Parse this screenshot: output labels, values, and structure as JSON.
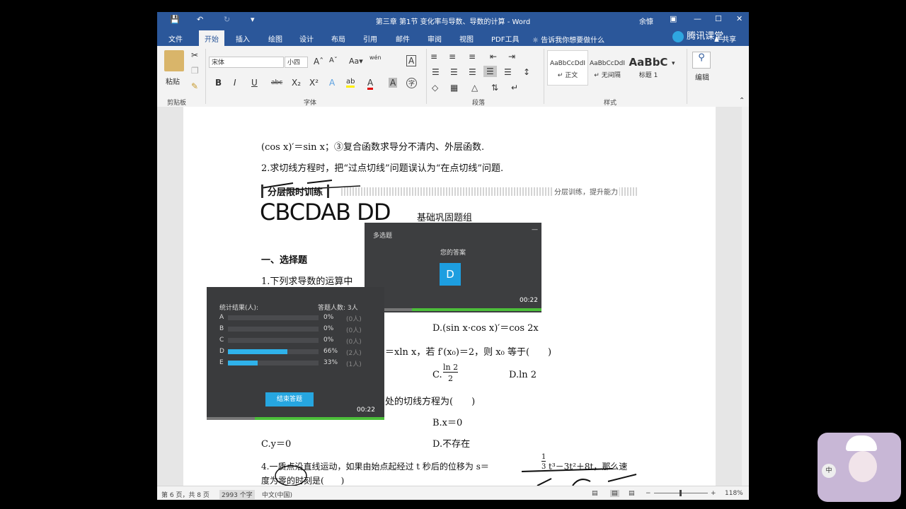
{
  "titlebar": {
    "title": "第三章 第1节 变化率与导数、导数的计算 - Word",
    "user": "余慷"
  },
  "tabs": [
    "文件",
    "开始",
    "插入",
    "绘图",
    "设计",
    "布局",
    "引用",
    "邮件",
    "审阅",
    "视图",
    "PDF工具"
  ],
  "tell_me": "告诉我你想要做什么",
  "share": "共享",
  "brand": "腾讯课堂",
  "ribbon": {
    "paste_label": "粘贴",
    "font_name": "宋体",
    "font_size": "小四",
    "styles": [
      {
        "preview": "AaBbCcDdI",
        "name": "↵ 正文"
      },
      {
        "preview": "AaBbCcDdI",
        "name": "↵ 无间隔"
      },
      {
        "preview": "AaBbC",
        "name": "标题 1"
      }
    ],
    "edit_label": "编辑",
    "group_labels": {
      "clipboard": "剪贴板",
      "font": "字体",
      "paragraph": "段落",
      "styles": "样式"
    }
  },
  "document": {
    "lines": [
      "(cos x)′＝sin x；③复合函数求导分不清内、外层函数.",
      "2.求切线方程时，把“过点切线”问题误认为“在点切线”问题.",
      "分层限时训练",
      "分层训练，提升能力",
      "CBCDAB DD",
      "基础巩固题组",
      "一、选择题",
      "1.下列求导数的运算中",
      "D.(sin x·cos x)′＝cos 2x",
      "＝xln x，若 f′(x₀)＝2，则 x₀ 等于(　　)",
      "C.",
      "ln 2",
      "2",
      "D.ln 2",
      "处的切线方程为(　　)",
      "B.x＝0",
      "C.y＝0",
      "D.不存在",
      "4.一质点沿直线运动，如果由始点起经过 t 秒后的位移为 s＝",
      "1",
      "3",
      "t³－3t²＋8t，那么速",
      "度为零的时刻是(　　)"
    ]
  },
  "status": {
    "page": "第 6 页，共 8 页",
    "words": "2993 个字",
    "lang": "中文(中国)",
    "zoom": "118%"
  },
  "quiz_answer": {
    "title": "多选题",
    "label": "您的答案",
    "answer": "D",
    "time": "00:22",
    "progress": 0.27
  },
  "quiz_stats": {
    "title": "统计结果(人):",
    "total": "答题人数: 3人",
    "options": [
      {
        "label": "A",
        "pct": "0%",
        "count": "(0人)",
        "value": 0
      },
      {
        "label": "B",
        "pct": "0%",
        "count": "(0人)",
        "value": 0
      },
      {
        "label": "C",
        "pct": "0%",
        "count": "(0人)",
        "value": 0
      },
      {
        "label": "D",
        "pct": "66%",
        "count": "(2人)",
        "value": 66
      },
      {
        "label": "E",
        "pct": "33%",
        "count": "(1人)",
        "value": 33
      }
    ],
    "end_button": "结束答题",
    "time": "00:22",
    "progress": 0.27
  }
}
